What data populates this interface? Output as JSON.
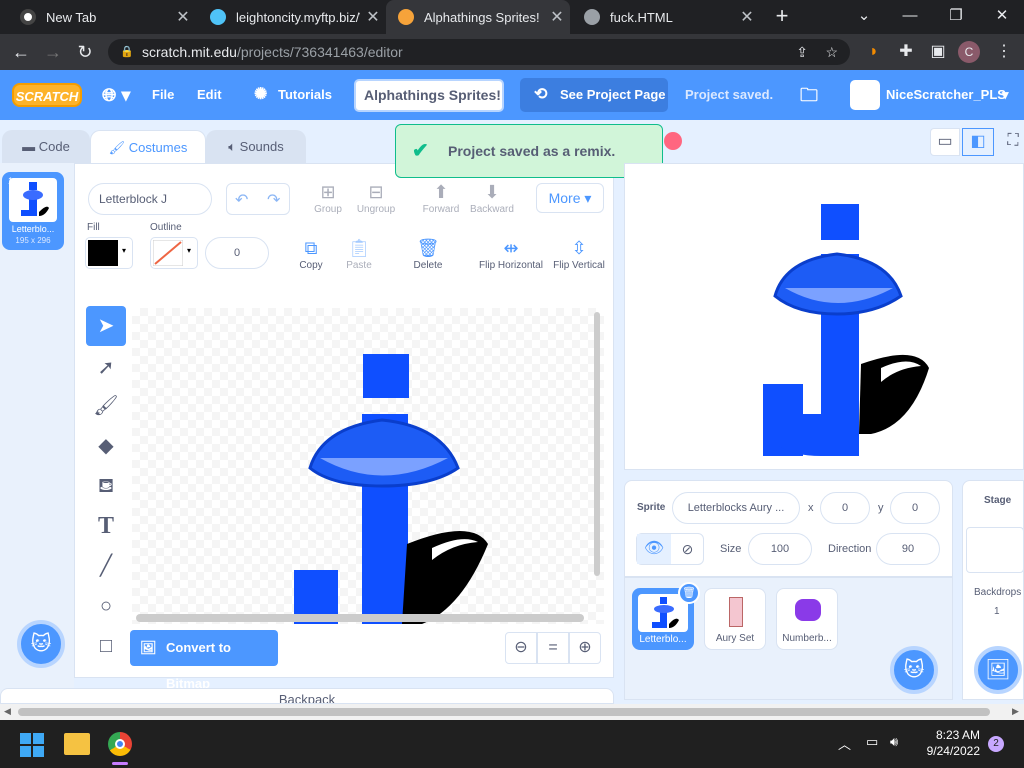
{
  "browser": {
    "tabs": [
      {
        "title": "New Tab",
        "active": false
      },
      {
        "title": "leightoncity.myftp.biz/Wi",
        "active": false
      },
      {
        "title": "Alphathings Sprites! re",
        "active": true
      },
      {
        "title": "fuck.HTML",
        "active": false
      }
    ],
    "url_host": "scratch.mit.edu",
    "url_path": "/projects/736341463/editor",
    "profile_initial": "C"
  },
  "menubar": {
    "logo": "SCRATCH",
    "file": "File",
    "edit": "Edit",
    "tutorials": "Tutorials",
    "project_title": "Alphathings Sprites! re",
    "see_project_page": "See Project Page",
    "status": "Project saved.",
    "username": "NiceScratcher_PLS"
  },
  "editor_tabs": {
    "code": "Code",
    "costumes": "Costumes",
    "sounds": "Sounds"
  },
  "toast": "Project saved as a remix.",
  "costume_list": [
    {
      "number": "1",
      "name": "Letterblo...",
      "size": "195 x 296"
    }
  ],
  "paint": {
    "costume_name": "Letterblock J",
    "group": "Group",
    "ungroup": "Ungroup",
    "forward": "Forward",
    "backward": "Backward",
    "more": "More",
    "fill_label": "Fill",
    "outline_label": "Outline",
    "outline_width": "0",
    "copy": "Copy",
    "paste": "Paste",
    "delete": "Delete",
    "flip_horizontal": "Flip Horizontal",
    "flip_vertical": "Flip Vertical",
    "convert_to_bitmap": "Convert to Bitmap",
    "zoom_reset": "="
  },
  "sprite_info": {
    "sprite_label": "Sprite",
    "sprite_name": "Letterblocks Aury ...",
    "x_label": "x",
    "x": "0",
    "y_label": "y",
    "y": "0",
    "show_label": "Show",
    "size_label": "Size",
    "size": "100",
    "direction_label": "Direction",
    "direction": "90"
  },
  "sprites": [
    {
      "name": "Letterblo...",
      "selected": true
    },
    {
      "name": "Aury Set",
      "selected": false
    },
    {
      "name": "Numberb...",
      "selected": false
    }
  ],
  "stage_panel": {
    "title": "Stage",
    "backdrops_label": "Backdrops",
    "backdrops_count": "1"
  },
  "backpack": "Backpack",
  "taskbar": {
    "time": "8:23 AM",
    "date": "9/24/2022",
    "notifications": "2"
  },
  "colors": {
    "scratch_blue": "#4c97ff",
    "letter_blue": "#0f4fff",
    "toast_green": "#0fbd8c"
  }
}
